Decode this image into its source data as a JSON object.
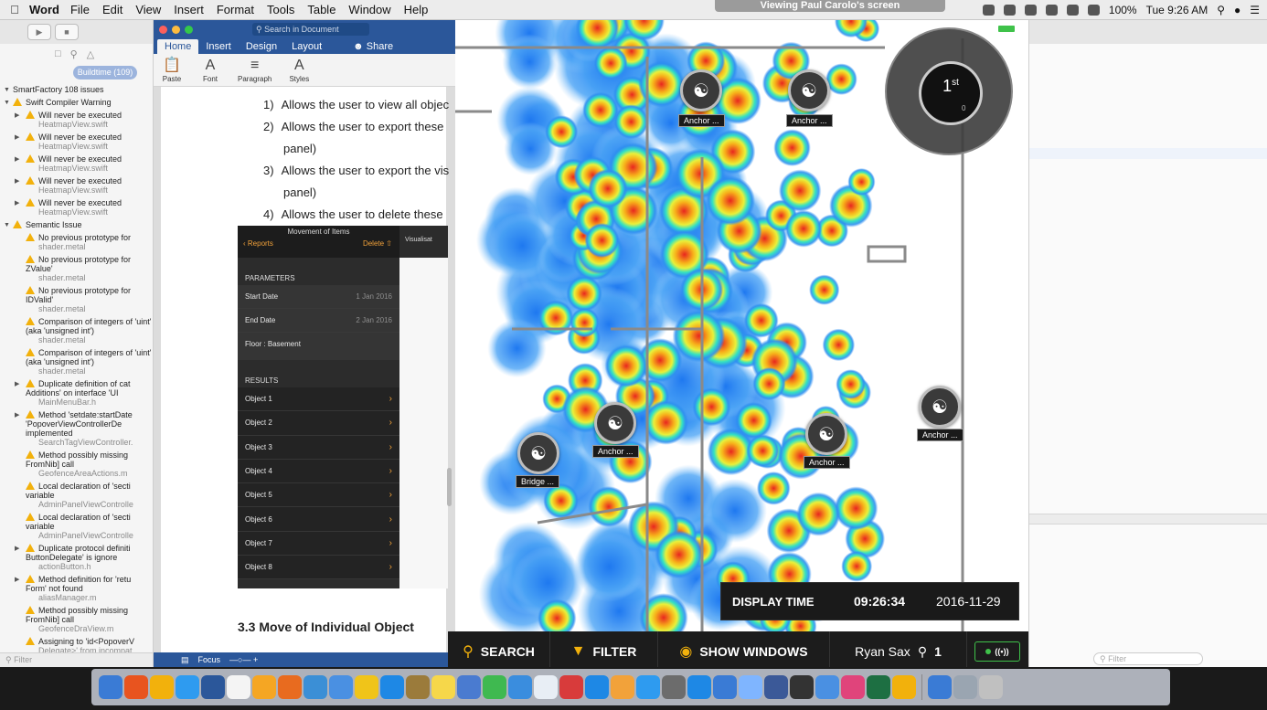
{
  "menubar": {
    "app": "Word",
    "items": [
      "File",
      "Edit",
      "View",
      "Insert",
      "Format",
      "Tools",
      "Table",
      "Window",
      "Help"
    ],
    "battery": "100%",
    "clock": "Tue 9:26 AM",
    "share_banner": "Viewing Paul Carolo's screen"
  },
  "xcode": {
    "pill": "Buildtime (109)",
    "project": "SmartFactory 108 issues",
    "filter_placeholder": "Filter",
    "groups": [
      {
        "title": "Swift Compiler Warning",
        "items": [
          {
            "msg": "Will never be executed",
            "file": "HeatmapView.swift"
          },
          {
            "msg": "Will never be executed",
            "file": "HeatmapView.swift"
          },
          {
            "msg": "Will never be executed",
            "file": "HeatmapView.swift"
          },
          {
            "msg": "Will never be executed",
            "file": "HeatmapView.swift"
          },
          {
            "msg": "Will never be executed",
            "file": "HeatmapView.swift"
          }
        ]
      },
      {
        "title": "Semantic Issue",
        "items": [
          {
            "msg": "No previous prototype for",
            "file": "shader.metal"
          },
          {
            "msg": "No previous prototype for ZValue'",
            "file": "shader.metal"
          },
          {
            "msg": "No previous prototype for IDValid'",
            "file": "shader.metal"
          },
          {
            "msg": "Comparison of integers of 'uint' (aka 'unsigned int')",
            "file": "shader.metal"
          },
          {
            "msg": "Comparison of integers of 'uint' (aka 'unsigned int')",
            "file": "shader.metal"
          },
          {
            "msg": "Duplicate definition of cat Additions' on interface 'UI",
            "file": "MainMenuBar.h"
          },
          {
            "msg": "Method 'setdate:startDate 'PopoverViewControllerDe implemented",
            "file": "SearchTagViewController."
          },
          {
            "msg": "Method possibly missing FromNib] call",
            "file": "GeofenceAreaActions.m"
          },
          {
            "msg": "Local declaration of 'secti variable",
            "file": "AdminPanelViewControlle"
          },
          {
            "msg": "Local declaration of 'secti variable",
            "file": "AdminPanelViewControlle"
          },
          {
            "msg": "Duplicate protocol definiti ButtonDelegate' is ignore",
            "file": "actionButton.h"
          },
          {
            "msg": "Method definition for 'retu Form' not found",
            "file": "aliasManager.m"
          },
          {
            "msg": "Method possibly missing FromNib] call",
            "file": "GeofenceDraView.m"
          },
          {
            "msg": "Assigning to 'id<PopoverV",
            "file": "Delegate>' from incompat"
          }
        ]
      }
    ]
  },
  "word": {
    "search_placeholder": "Search in Document",
    "tabs": [
      "Home",
      "Insert",
      "Design",
      "Layout"
    ],
    "share": "Share",
    "ribbon": [
      "Paste",
      "Font",
      "Paragraph",
      "Styles"
    ],
    "list": [
      {
        "num": "1)",
        "text": "Allows the user to view all objec"
      },
      {
        "num": "2)",
        "text": "Allows the user to export these"
      },
      {
        "num": "",
        "text": "panel)"
      },
      {
        "num": "3)",
        "text": "Allows the user to export the vis"
      },
      {
        "num": "",
        "text": "panel)"
      },
      {
        "num": "4)",
        "text": "Allows the user to delete these"
      }
    ],
    "heading": "3.3  Move of Individual Object",
    "focus": "Focus"
  },
  "ipad": {
    "title": "Movement of Items",
    "back": "Reports",
    "delete": "Delete",
    "vis_tab": "Visualisat",
    "parameters_header": "PARAMETERS",
    "start_label": "Start Date",
    "start_value": "1 Jan 2016",
    "end_label": "End Date",
    "end_value": "2 Jan 2016",
    "floor": "Floor : Basement",
    "results_header": "RESULTS",
    "objects": [
      "Object 1",
      "Object 2",
      "Object 3",
      "Object 4",
      "Object 5",
      "Object 6",
      "Object 7",
      "Object 8"
    ]
  },
  "heatmap": {
    "floor_label": "1",
    "floor_suffix": "st",
    "floor_sub": "0",
    "anchors": [
      {
        "label": "Anchor ..."
      },
      {
        "label": "Anchor ..."
      },
      {
        "label": "Anchor ..."
      },
      {
        "label": "Bridge ..."
      },
      {
        "label": "Anchor ..."
      },
      {
        "label": "Anchor ..."
      }
    ],
    "display_time_label": "DISPLAY TIME",
    "time": "09:26:34",
    "date": "2016-11-29"
  },
  "appbar": {
    "search": "SEARCH",
    "filter": "FILTER",
    "show_windows": "SHOW WINDOWS",
    "user": "Ryan Sax",
    "pin_count": "1"
  },
  "colors": {
    "word_blue": "#2b579a",
    "accent_orange": "#f2a23a",
    "live_green": "#3fc24a",
    "warning_yellow": "#f2b10c"
  }
}
